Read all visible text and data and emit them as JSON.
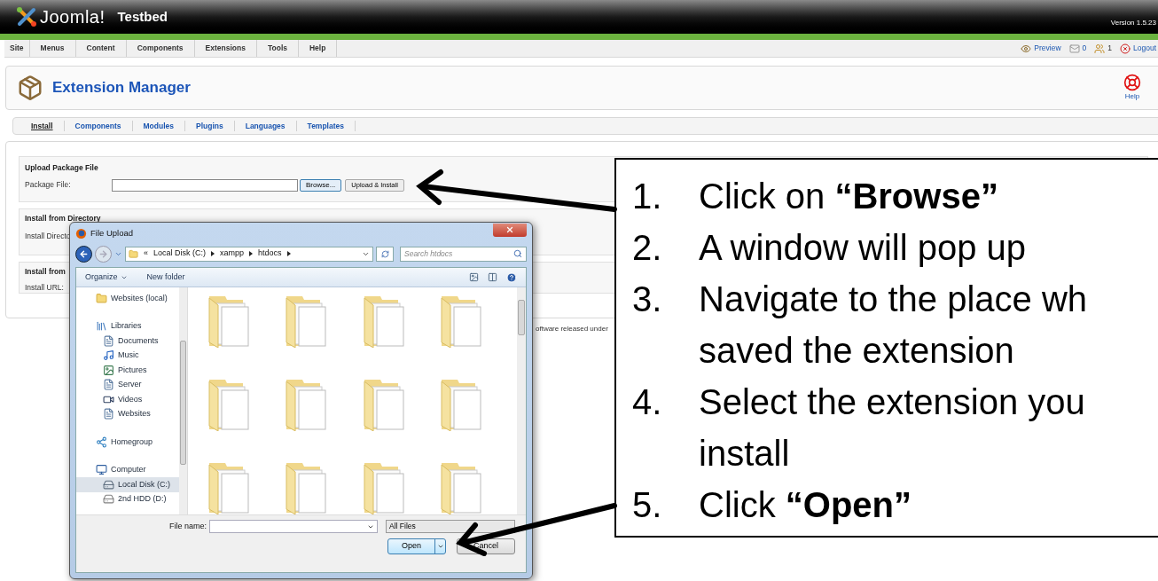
{
  "header": {
    "logo": "Joomla!",
    "site_name": "Testbed",
    "version": "Version 1.5.23"
  },
  "menu": {
    "items": [
      "Site",
      "Menus",
      "Content",
      "Components",
      "Extensions",
      "Tools",
      "Help"
    ],
    "status": [
      {
        "kind": "preview",
        "label": "Preview"
      },
      {
        "kind": "messages",
        "label": "0"
      },
      {
        "kind": "users",
        "label": "1"
      },
      {
        "kind": "logout",
        "label": "Logout"
      }
    ]
  },
  "toolbar": {
    "title": "Extension Manager",
    "help": "Help"
  },
  "subtabs": [
    {
      "label": "Install",
      "selected": true
    },
    {
      "label": "Components",
      "selected": false
    },
    {
      "label": "Modules",
      "selected": false
    },
    {
      "label": "Plugins",
      "selected": false
    },
    {
      "label": "Languages",
      "selected": false
    },
    {
      "label": "Templates",
      "selected": false
    }
  ],
  "upload": {
    "title": "Upload Package File",
    "label": "Package File:",
    "browse": "Browse...",
    "install": "Upload & Install"
  },
  "directory": {
    "title": "Install from Directory",
    "label": "Install Directo"
  },
  "url": {
    "title": "Install from",
    "label": "Install URL:"
  },
  "footer_text": "oftware released under",
  "dialog": {
    "title": "File Upload",
    "path_prefix": "«",
    "crumbs": [
      "Local Disk (C:)",
      "xampp",
      "htdocs"
    ],
    "search": {
      "placeholder": "Search htdocs"
    },
    "toolbar": [
      "Organize",
      "New folder"
    ],
    "nav": [
      {
        "kind": "folder",
        "label": "Websites (local)",
        "selected": false
      },
      {
        "kind": "library",
        "label": "Libraries",
        "selected": false,
        "children": [
          {
            "kind": "document",
            "label": "Documents",
            "selected": false
          },
          {
            "kind": "music",
            "label": "Music",
            "selected": false
          },
          {
            "kind": "picture",
            "label": "Pictures",
            "selected": false
          },
          {
            "kind": "document",
            "label": "Server",
            "selected": false
          },
          {
            "kind": "video",
            "label": "Videos",
            "selected": false
          },
          {
            "kind": "document",
            "label": "Websites",
            "selected": false
          }
        ]
      },
      {
        "kind": "homegroup",
        "label": "Homegroup",
        "selected": false
      },
      {
        "kind": "computer",
        "label": "Computer",
        "selected": false,
        "children": [
          {
            "kind": "disk",
            "label": "Local Disk (C:)",
            "selected": true
          },
          {
            "kind": "drive",
            "label": "2nd HDD (D:)",
            "selected": false
          }
        ]
      }
    ],
    "file_name_label": "File name:",
    "filter": "All Files",
    "open": "Open",
    "cancel": "Cancel"
  },
  "callout": {
    "steps": [
      {
        "number": "1.",
        "lines": [
          "Click on **“Browse”**"
        ]
      },
      {
        "number": "2.",
        "lines": [
          "A window will pop up"
        ]
      },
      {
        "number": "3.",
        "lines": [
          "Navigate to the place wh",
          "saved the extension"
        ]
      },
      {
        "number": "4.",
        "lines": [
          "Select the extension you",
          "install"
        ]
      },
      {
        "number": "5.",
        "lines": [
          "Click **“Open”**"
        ]
      }
    ]
  }
}
